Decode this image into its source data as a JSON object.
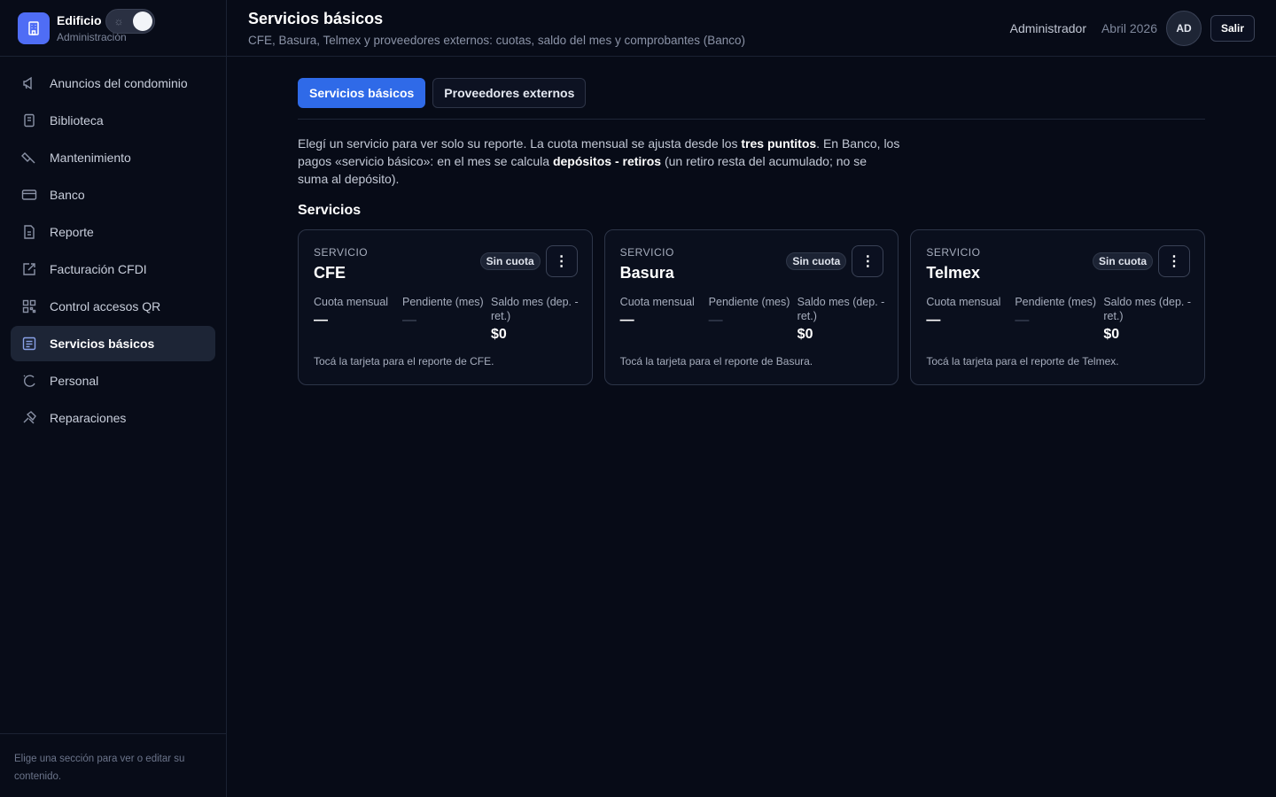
{
  "brand": {
    "name": "Edificio",
    "subtitle": "Administración",
    "theme_icon": "sun-icon"
  },
  "sidebar": {
    "items": [
      {
        "label": "Anuncios del condominio",
        "icon": "megaphone-icon"
      },
      {
        "label": "Biblioteca",
        "icon": "book-icon"
      },
      {
        "label": "Mantenimiento",
        "icon": "wrench-icon"
      },
      {
        "label": "Banco",
        "icon": "card-icon"
      },
      {
        "label": "Reporte",
        "icon": "document-icon"
      },
      {
        "label": "Facturación CFDI",
        "icon": "external-edit-icon"
      },
      {
        "label": "Control accesos QR",
        "icon": "qr-icon"
      },
      {
        "label": "Servicios básicos",
        "icon": "list-icon",
        "active": true
      },
      {
        "label": "Personal",
        "icon": "loader-icon"
      },
      {
        "label": "Reparaciones",
        "icon": "hammer-icon"
      }
    ],
    "footer": "Elige una sección para ver o editar su contenido."
  },
  "header": {
    "title": "Servicios básicos",
    "subtitle": "CFE, Basura, Telmex y proveedores externos: cuotas, saldo del mes y comprobantes (Banco)",
    "role": "Administrador",
    "period": "Abril 2026",
    "avatar_initials": "AD",
    "logout_label": "Salir"
  },
  "tabs": [
    {
      "label": "Servicios básicos",
      "active": true
    },
    {
      "label": "Proveedores externos",
      "active": false
    }
  ],
  "intro": {
    "part1": "Elegí un servicio para ver solo su reporte. La cuota mensual se ajusta desde los ",
    "bold1": "tres puntitos",
    "part2": ". En Banco, los pagos «servicio básico»: en el mes se calcula ",
    "bold2": "depósitos - retiros",
    "part3": " (un retiro resta del acumulado; no se suma al depósito)."
  },
  "section_title": "Servicios",
  "cards": [
    {
      "kicker": "SERVICIO",
      "name": "CFE",
      "badge": "Sin cuota",
      "menu_icon": "⋮",
      "quota_label": "Cuota mensual",
      "quota_value": "—",
      "pending_label": "Pendiente (mes)",
      "pending_value": "—",
      "balance_label": "Saldo mes (dep. - ret.)",
      "balance_value": "$0",
      "hint": "Tocá la tarjeta para el reporte de CFE."
    },
    {
      "kicker": "SERVICIO",
      "name": "Basura",
      "badge": "Sin cuota",
      "menu_icon": "⋮",
      "quota_label": "Cuota mensual",
      "quota_value": "—",
      "pending_label": "Pendiente (mes)",
      "pending_value": "—",
      "balance_label": "Saldo mes (dep. - ret.)",
      "balance_value": "$0",
      "hint": "Tocá la tarjeta para el reporte de Basura."
    },
    {
      "kicker": "SERVICIO",
      "name": "Telmex",
      "badge": "Sin cuota",
      "menu_icon": "⋮",
      "quota_label": "Cuota mensual",
      "quota_value": "—",
      "pending_label": "Pendiente (mes)",
      "pending_value": "—",
      "balance_label": "Saldo mes (dep. - ret.)",
      "balance_value": "$0",
      "hint": "Tocá la tarjeta para el reporte de Telmex."
    }
  ],
  "colors": {
    "accent": "#2f6ae8",
    "brand_logo": "#4f6df5",
    "background": "#070b17"
  }
}
